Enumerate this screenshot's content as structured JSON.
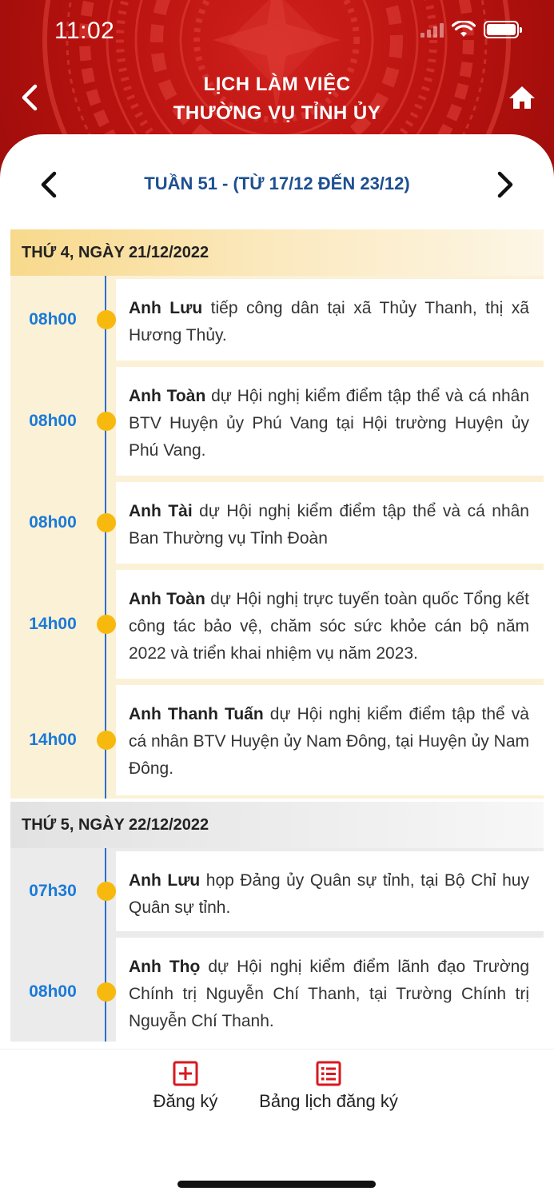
{
  "status_bar": {
    "time": "11:02"
  },
  "header": {
    "title_line1": "LỊCH LÀM VIỆC",
    "title_line2": "THƯỜNG VỤ TỈNH ỦY"
  },
  "week_nav": {
    "label": "TUẦN 51 - (TỪ 17/12 ĐẾN 23/12)"
  },
  "days": [
    {
      "date_label": "THỨ 4, NGÀY 21/12/2022",
      "events": [
        {
          "time": "08h00",
          "person": "Anh Lưu",
          "description": " tiếp công dân tại xã Thủy Thanh, thị xã Hương Thủy."
        },
        {
          "time": "08h00",
          "person": "Anh Toàn",
          "description": " dự Hội nghị kiểm điểm tập thể và cá nhân BTV Huyện ủy Phú Vang tại Hội trường Huyện ủy Phú Vang."
        },
        {
          "time": "08h00",
          "person": "Anh Tài",
          "description": " dự Hội nghị kiểm điểm tập thể và cá nhân Ban Thường vụ Tỉnh Đoàn"
        },
        {
          "time": "14h00",
          "person": "Anh Toàn",
          "description": " dự Hội nghị trực tuyến toàn quốc Tổng kết công tác bảo vệ, chăm sóc sức khỏe cán bộ năm 2022 và triển khai nhiệm vụ năm 2023."
        },
        {
          "time": "14h00",
          "person": "Anh Thanh Tuấn",
          "description": " dự Hội nghị kiểm điểm tập thể và cá nhân BTV Huyện ủy Nam Đông, tại Huyện ủy Nam Đông."
        }
      ]
    },
    {
      "date_label": "THỨ 5, NGÀY 22/12/2022",
      "events": [
        {
          "time": "07h30",
          "person": "Anh Lưu",
          "description": " họp Đảng ủy Quân sự tỉnh, tại Bộ Chỉ huy Quân sự tỉnh."
        },
        {
          "time": "08h00",
          "person": "Anh Thọ",
          "description": " dự Hội nghị kiểm điểm lãnh đạo Trường Chính trị Nguyễn Chí Thanh, tại Trường Chính trị Nguyễn Chí Thanh."
        }
      ]
    }
  ],
  "bottom_bar": {
    "register_label": "Đăng ký",
    "schedule_label": "Bảng lịch đăng ký"
  },
  "colors": {
    "header_red": "#b8120f",
    "accent_blue": "#1d4f91",
    "time_blue": "#1a7ad8",
    "dot_yellow": "#f8b90f",
    "icon_red": "#d7191f"
  }
}
